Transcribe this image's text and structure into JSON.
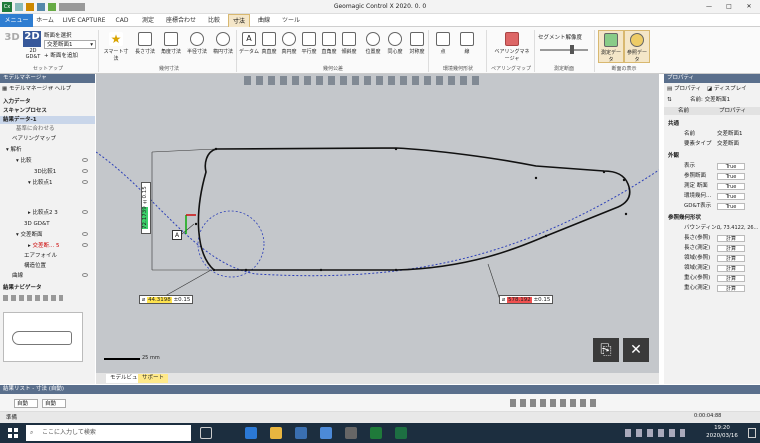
{
  "window": {
    "title": "Geomagic Control X 2020. 0. 0"
  },
  "tabs": [
    {
      "label": "メニュー"
    },
    {
      "label": "ホーム"
    },
    {
      "label": "LIVE CAPTURE"
    },
    {
      "label": "CAD"
    },
    {
      "label": "測定"
    },
    {
      "label": "座標合わせ"
    },
    {
      "label": "比較"
    },
    {
      "label": "寸法"
    },
    {
      "label": "曲線"
    },
    {
      "label": "ツール"
    }
  ],
  "ribbon": {
    "mode3d": "3D",
    "mode2d": "2D",
    "mode2d_sub": "2D GD&T",
    "select_section": "断面を選択",
    "section_value": "交差断面1",
    "add_section": "断面を追加",
    "g_setup": "セットアップ",
    "g_dim": "幾何寸法",
    "g_geo": "幾何公差",
    "g_ref": "環境幾何形状",
    "g_bmap": "ペアリングマップ",
    "g_meas": "測定断面",
    "g_disp": "断面の表示",
    "buttons": [
      "スマート寸法",
      "長さ寸法",
      "角度寸法",
      "半径寸法",
      "楕円寸法",
      "データム",
      "真直度",
      "真円度",
      "平行度",
      "直角度",
      "傾斜度",
      "位置度",
      "同心度",
      "対称度",
      "点",
      "線",
      "ベアリングマネージャ",
      "セグメント解像度",
      "測定データ",
      "参照データ"
    ]
  },
  "model_manager": {
    "title": "モデルマネージャ",
    "tab1": "モデルマネージャ",
    "tab2": "ヘルプ",
    "rows": [
      "入力データ",
      "スキャンプロセス",
      "結果データ-1",
      "基準に合わせる",
      "ベアリングマップ",
      "解析",
      "比較",
      "3D比較1",
      "比較点1",
      "比較点2 3",
      "3D GD&T",
      "交差断面",
      "交差断... 5",
      "エアフォイル",
      "構造位置",
      "曲線"
    ],
    "nav_title": "結果ナビゲータ"
  },
  "view": {
    "dim_vertical": "72.1739",
    "dim_vertical_tol": "±0.15",
    "label_a": "A",
    "dim_left": "44.3198",
    "dim_left_tol": "±0.15",
    "dim_right": "578.192",
    "dim_right_tol": "±0.15",
    "scale": "25 mm",
    "tab1": "モデルビュー",
    "tab2": "サポート"
  },
  "properties": {
    "title": "プロパティ",
    "tab1": "プロパティ",
    "tab2": "ディスプレイ",
    "name_label": "名前: 交差断面1",
    "col1": "名前",
    "col2": "プロパティ",
    "sections": [
      "共通",
      "外観",
      "参照幾何形状"
    ],
    "rows": [
      {
        "name": "名前",
        "value": "交差断面1"
      },
      {
        "name": "要素タイプ",
        "value": "交差断面"
      },
      {
        "name": "表示",
        "value": "True"
      },
      {
        "name": "参照断面",
        "value": "True"
      },
      {
        "name": "測定 断面",
        "value": "True"
      },
      {
        "name": "環境幾何...",
        "value": "True"
      },
      {
        "name": "GD&T表示",
        "value": "True"
      },
      {
        "name": "バウンディン...",
        "value": "0, 73.4122, 26..."
      },
      {
        "name": "長さ(参照)",
        "value": "計算"
      },
      {
        "name": "長さ(測定)",
        "value": "計算"
      },
      {
        "name": "領域(参照)",
        "value": "計算"
      },
      {
        "name": "領域(測定)",
        "value": "計算"
      },
      {
        "name": "重心(参照)",
        "value": "計算"
      },
      {
        "name": "重心(測定)",
        "value": "計算"
      }
    ]
  },
  "bottom": {
    "result_list": "結果リスト - 寸法 (自動)",
    "auto1": "自動",
    "auto2": "自動",
    "status": "準備",
    "time": "0:00:04:88"
  },
  "taskbar": {
    "search": "ここに入力して検索",
    "time": "19:20",
    "date": "2020/03/16"
  }
}
